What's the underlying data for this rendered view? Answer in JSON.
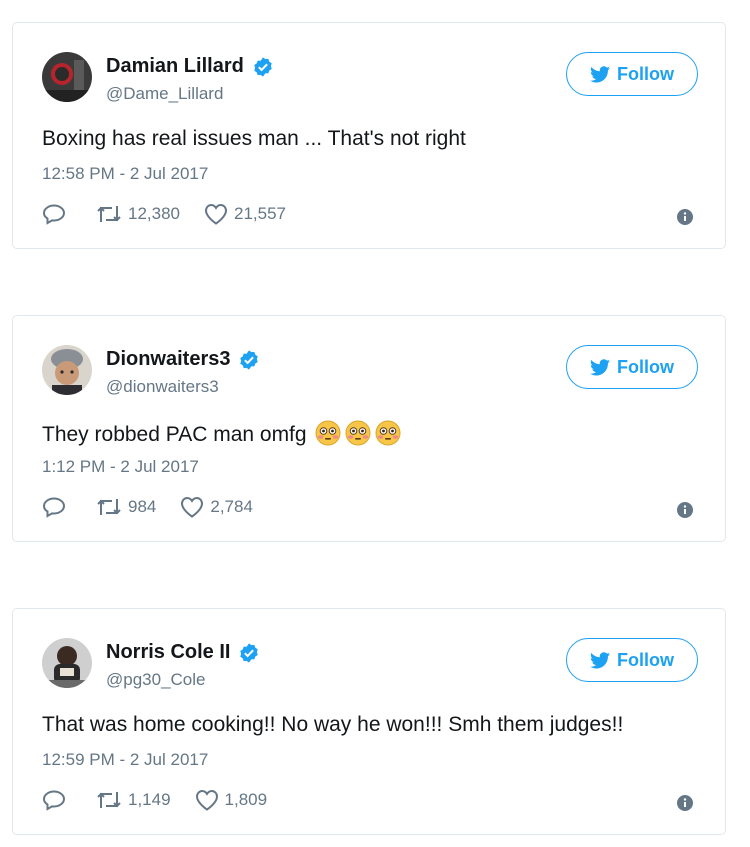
{
  "tweets": [
    {
      "name": "Damian Lillard",
      "handle": "@Dame_Lillard",
      "text": "Boxing has real issues man ... That's not right",
      "time": "12:58 PM - 2 Jul 2017",
      "retweets": "12,380",
      "likes": "21,557",
      "follow_label": "Follow",
      "emojis": 0
    },
    {
      "name": "Dionwaiters3",
      "handle": "@dionwaiters3",
      "text": "They robbed PAC man omfg",
      "time": "1:12 PM - 2 Jul 2017",
      "retweets": "984",
      "likes": "2,784",
      "follow_label": "Follow",
      "emojis": 3
    },
    {
      "name": "Norris Cole II",
      "handle": "@pg30_Cole",
      "text": "That was home cooking!! No way he won!!! Smh them judges!!",
      "time": "12:59 PM - 2 Jul 2017",
      "retweets": "1,149",
      "likes": "1,809",
      "follow_label": "Follow",
      "emojis": 0
    }
  ],
  "icons": {
    "verified": "verified-badge-icon",
    "bird": "twitter-bird-icon",
    "reply": "reply-icon",
    "retweet": "retweet-icon",
    "like": "heart-icon",
    "info": "info-icon",
    "emoji": "flushed-face-emoji"
  },
  "colors": {
    "brand": "#1da1f2",
    "secondary_text": "#657786",
    "border": "#e1e8ed"
  }
}
